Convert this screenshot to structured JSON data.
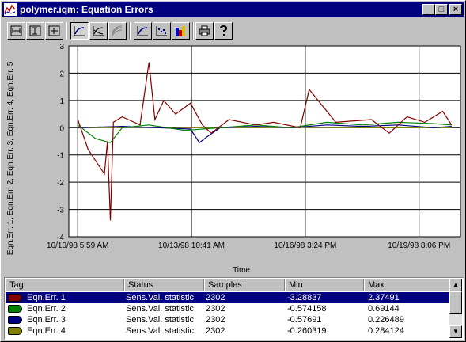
{
  "window": {
    "title": "polymer.iqm: Equation Errors",
    "buttons": {
      "minimize": "_",
      "maximize": "□",
      "close": "×"
    }
  },
  "toolbar": {
    "buttons": [
      {
        "name": "zoom-x-button",
        "icon": "zoom-x-icon",
        "pressed": false
      },
      {
        "name": "zoom-y-button",
        "icon": "zoom-y-icon",
        "pressed": false
      },
      {
        "name": "zoom-xy-button",
        "icon": "zoom-xy-icon",
        "pressed": false
      },
      {
        "name": "trend-button",
        "icon": "trend-line-icon",
        "pressed": true
      },
      {
        "name": "compare-button",
        "icon": "compare-lines-icon",
        "pressed": false
      },
      {
        "name": "overlay-button",
        "icon": "overlay-lines-icon",
        "pressed": false
      },
      {
        "name": "line-plot-button",
        "icon": "line-plot-icon",
        "pressed": false
      },
      {
        "name": "scatter-plot-button",
        "icon": "scatter-plot-icon",
        "pressed": false
      },
      {
        "name": "bar-chart-button",
        "icon": "bar-chart-icon",
        "pressed": false
      },
      {
        "name": "print-button",
        "icon": "printer-icon",
        "pressed": false
      },
      {
        "name": "help-button",
        "icon": "help-icon",
        "pressed": false
      }
    ]
  },
  "chart_data": {
    "type": "line",
    "title": "",
    "xlabel": "Time",
    "ylabel": "Eqn.Err. 1, Eqn.Err. 2, Eqn.Err. 3, Eqn.Err. 4, Eqn.Err. 5",
    "ylim": [
      -4,
      3
    ],
    "yticks": [
      3,
      2,
      1,
      0,
      -1,
      -2,
      -3,
      -4
    ],
    "xlim": [
      "10/10/98 12:00 AM",
      "10/21/98 12:00 AM"
    ],
    "xtick_labels": [
      "10/10/98 5:59 AM",
      "10/13/98 10:41 AM",
      "10/16/98 3:24 PM",
      "10/19/98 8:06 PM"
    ],
    "grid": true,
    "series": [
      {
        "name": "Eqn.Err. 1",
        "color": "#800000",
        "x": [
          "10/10/98 6:00 AM",
          "10/10/98 1:00 PM",
          "10/11/98 12:00 AM",
          "10/11/98 2:00 AM",
          "10/11/98 4:00 AM",
          "10/11/98 6:00 AM",
          "10/11/98 12:00 PM",
          "10/12/98 12:00 AM",
          "10/12/98 6:00 AM",
          "10/12/98 10:00 AM",
          "10/12/98 4:00 PM",
          "10/13/98 12:00 AM",
          "10/13/98 10:00 AM",
          "10/13/98 6:00 PM",
          "10/14/98 12:00 AM",
          "10/14/98 12:00 PM",
          "10/15/98 6:00 AM",
          "10/15/98 6:00 PM",
          "10/16/98 12:00 PM",
          "10/16/98 6:00 PM",
          "10/17/98 12:00 PM",
          "10/18/98 12:00 PM",
          "10/19/98 12:00 AM",
          "10/19/98 12:00 PM",
          "10/20/98 12:00 AM",
          "10/20/98 12:00 PM",
          "10/20/98 6:00 PM"
        ],
        "y": [
          0.3,
          -0.8,
          -1.7,
          -0.5,
          -3.4,
          0.2,
          0.4,
          0.1,
          2.4,
          0.3,
          1.0,
          0.5,
          0.9,
          0.1,
          -0.2,
          0.3,
          0.1,
          0.2,
          0.0,
          1.4,
          0.2,
          0.3,
          -0.2,
          0.4,
          0.2,
          0.6,
          0.1
        ]
      },
      {
        "name": "Eqn.Err. 2",
        "color": "#008000",
        "x": [
          "10/10/98 6:00 AM",
          "10/10/98 6:00 PM",
          "10/11/98 4:00 AM",
          "10/11/98 12:00 PM",
          "10/12/98 6:00 AM",
          "10/13/98 6:00 AM",
          "10/14/98 6:00 AM",
          "10/15/98 6:00 AM",
          "10/16/98 6:00 AM",
          "10/17/98 6:00 AM",
          "10/18/98 6:00 AM",
          "10/19/98 6:00 AM",
          "10/20/98 6:00 AM",
          "10/20/98 6:00 PM"
        ],
        "y": [
          0.1,
          -0.4,
          -0.55,
          0.0,
          0.1,
          -0.1,
          0.0,
          0.1,
          0.0,
          0.2,
          0.1,
          0.2,
          0.15,
          0.1
        ]
      },
      {
        "name": "Eqn.Err. 3",
        "color": "#000080",
        "x": [
          "10/10/98 6:00 AM",
          "10/11/98 12:00 PM",
          "10/12/98 12:00 PM",
          "10/13/98 10:00 AM",
          "10/13/98 4:00 PM",
          "10/13/98 10:00 PM",
          "10/14/98 6:00 AM",
          "10/15/98 6:00 AM",
          "10/16/98 6:00 AM",
          "10/17/98 6:00 AM",
          "10/18/98 6:00 AM",
          "10/19/98 6:00 AM",
          "10/20/98 6:00 AM",
          "10/20/98 6:00 PM"
        ],
        "y": [
          0.0,
          0.05,
          0.0,
          -0.05,
          -0.55,
          -0.3,
          0.0,
          0.05,
          0.0,
          0.1,
          0.05,
          0.1,
          0.0,
          0.05
        ]
      },
      {
        "name": "Eqn.Err. 4",
        "color": "#808000",
        "x": [
          "10/10/98 6:00 AM",
          "10/12/98 6:00 AM",
          "10/14/98 6:00 AM",
          "10/16/98 6:00 AM",
          "10/18/98 6:00 AM",
          "10/20/98 6:00 PM"
        ],
        "y": [
          0.0,
          0.02,
          0.0,
          0.01,
          0.0,
          0.0
        ]
      }
    ]
  },
  "legend": {
    "columns": [
      "Tag",
      "Status",
      "Samples",
      "Min",
      "Max"
    ],
    "rows": [
      {
        "tag": "Eqn.Err. 1",
        "status": "Sens.Val. statistic",
        "samples": "2302",
        "min": "-3.28837",
        "max": "2.37491",
        "color": "#800000",
        "selected": true
      },
      {
        "tag": "Eqn.Err. 2",
        "status": "Sens.Val. statistic",
        "samples": "2302",
        "min": "-0.574158",
        "max": "0.69144",
        "color": "#008000",
        "selected": false
      },
      {
        "tag": "Eqn.Err. 3",
        "status": "Sens.Val. statistic",
        "samples": "2302",
        "min": "-0.57691",
        "max": "0.226489",
        "color": "#000080",
        "selected": false
      },
      {
        "tag": "Eqn.Err. 4",
        "status": "Sens.Val. statistic",
        "samples": "2302",
        "min": "-0.260319",
        "max": "0.284124",
        "color": "#808000",
        "selected": false
      }
    ]
  }
}
